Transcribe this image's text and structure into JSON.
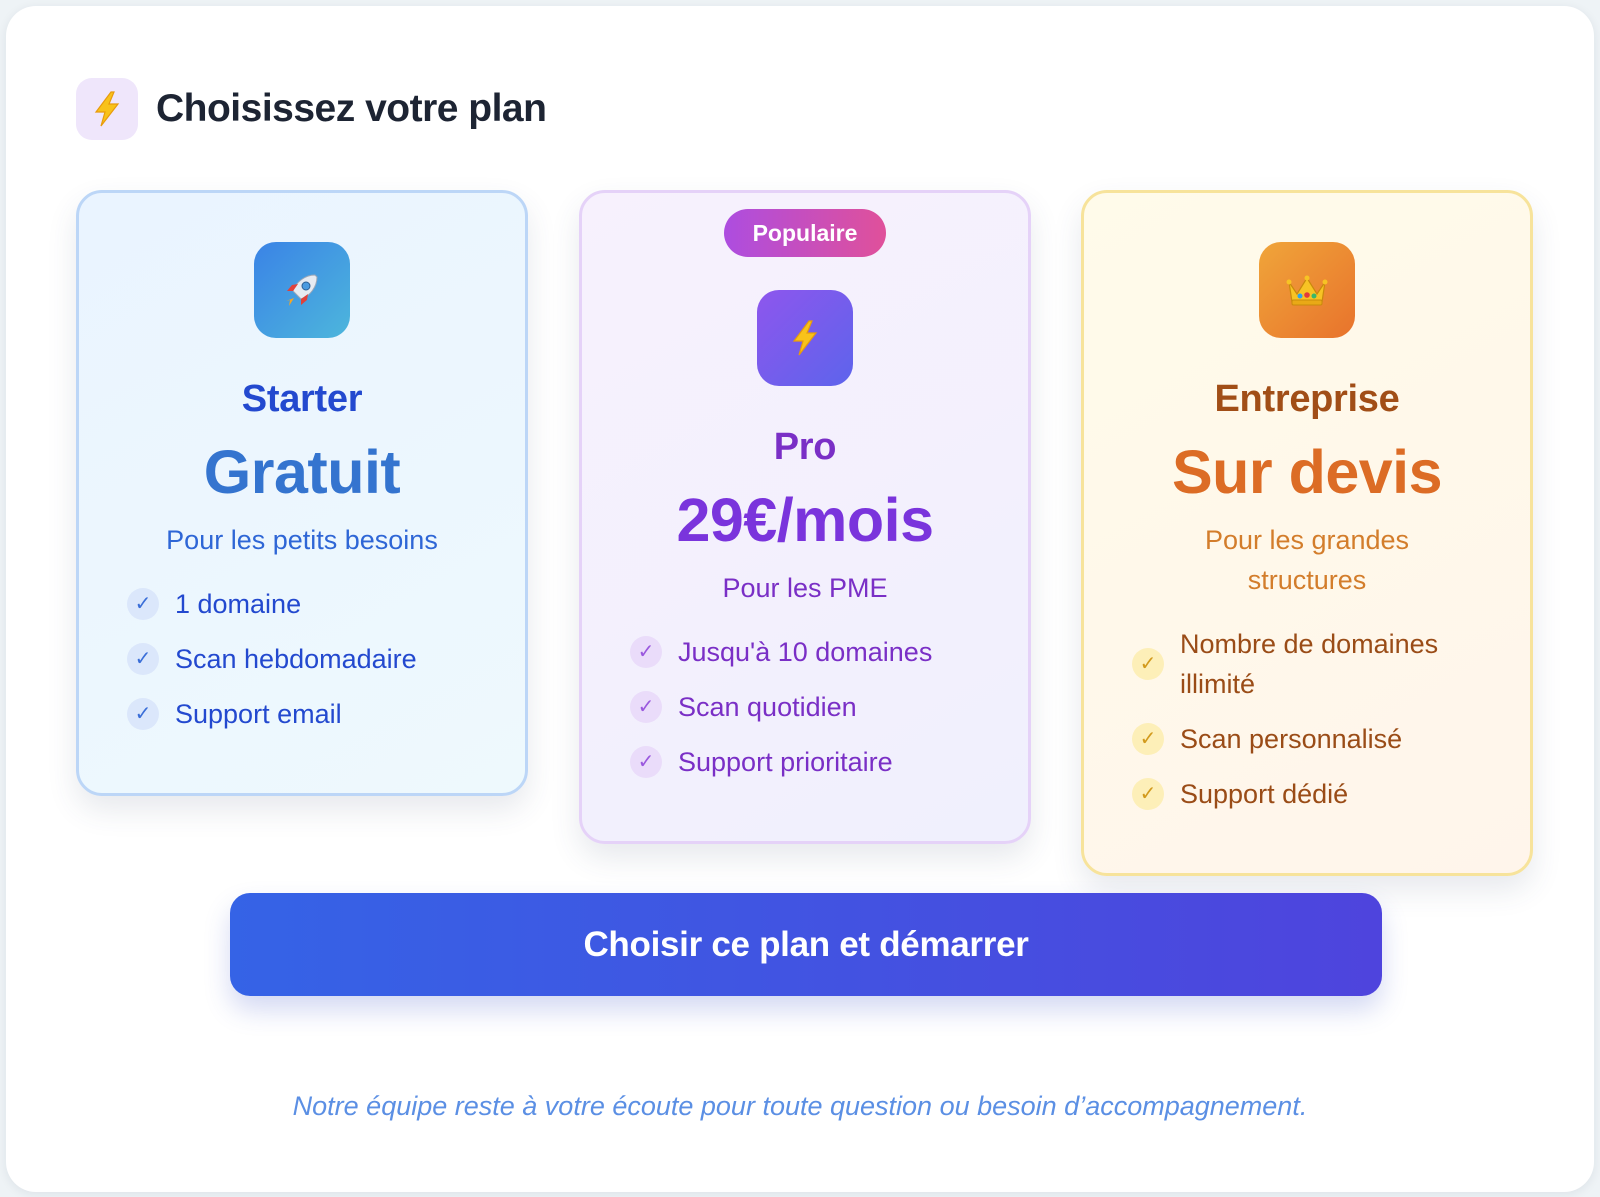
{
  "header": {
    "title": "Choisissez votre plan",
    "icon": "lightning-icon"
  },
  "plans": [
    {
      "icon": "rocket-icon",
      "name": "Starter",
      "price": "Gratuit",
      "subtitle": "Pour les petits besoins",
      "features": [
        "1 domaine",
        "Scan hebdomadaire",
        "Support email"
      ],
      "accent": "#2349cf"
    },
    {
      "badge": "Populaire",
      "icon": "lightning-icon",
      "name": "Pro",
      "price": "29€/mois",
      "subtitle": "Pour les PME",
      "features": [
        "Jusqu'à 10 domaines",
        "Scan quotidien",
        "Support prioritaire"
      ],
      "accent": "#7a2fc6"
    },
    {
      "icon": "crown-icon",
      "name": "Entreprise",
      "price": "Sur devis",
      "subtitle": "Pour les grandes structures",
      "features": [
        "Nombre de domaines illimité",
        "Scan personnalisé",
        "Support dédié"
      ],
      "accent": "#dc6c25"
    }
  ],
  "check_glyph": "✓",
  "cta": {
    "label": "Choisir ce plan et démarrer"
  },
  "footer": {
    "note": "Notre équipe reste à votre écoute pour toute question ou besoin d’accompagnement."
  }
}
